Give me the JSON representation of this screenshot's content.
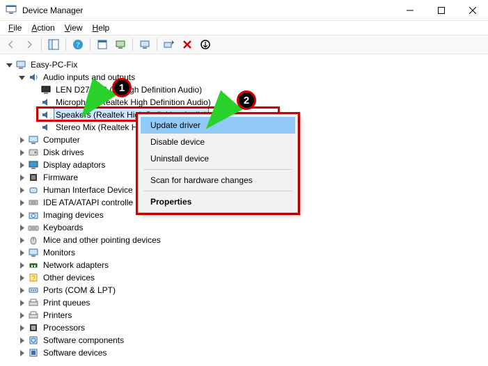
{
  "window": {
    "title": "Device Manager",
    "min": "Minimize",
    "max": "Maximize",
    "close": "Close"
  },
  "menus": {
    "file": "File",
    "action": "Action",
    "view": "View",
    "help": "Help"
  },
  "toolbar_tips": {
    "back": "Back",
    "forward": "Forward",
    "up": "Show/Hide Console Tree",
    "help": "Help",
    "props": "Properties",
    "monitor": "Update",
    "scan": "Scan for hardware changes",
    "uninstall": "Uninstall",
    "enable": "Enable"
  },
  "tree": {
    "root": "Easy-PC-Fix",
    "audio": "Audio inputs and outputs",
    "audio_children": {
      "len": "LEN D27-20B (      A High Definition Audio)",
      "mic": "Microphon    (Realtek High Definition Audio)",
      "spk": "Speakers (Realtek High Definition Audio)",
      "mix": "Stereo Mix (Realtek H"
    },
    "nodes": [
      "Computer",
      "Disk drives",
      "Display adaptors",
      "Firmware",
      "Human Interface Device",
      "IDE ATA/ATAPI controlle",
      "Imaging devices",
      "Keyboards",
      "Mice and other pointing devices",
      "Monitors",
      "Network adapters",
      "Other devices",
      "Ports (COM & LPT)",
      "Print queues",
      "Printers",
      "Processors",
      "Software components",
      "Software devices"
    ]
  },
  "context_menu": {
    "update": "Update driver",
    "disable": "Disable device",
    "uninstall": "Uninstall device",
    "scan": "Scan for hardware changes",
    "props": "Properties"
  },
  "annotations": {
    "one": "1",
    "two": "2"
  }
}
